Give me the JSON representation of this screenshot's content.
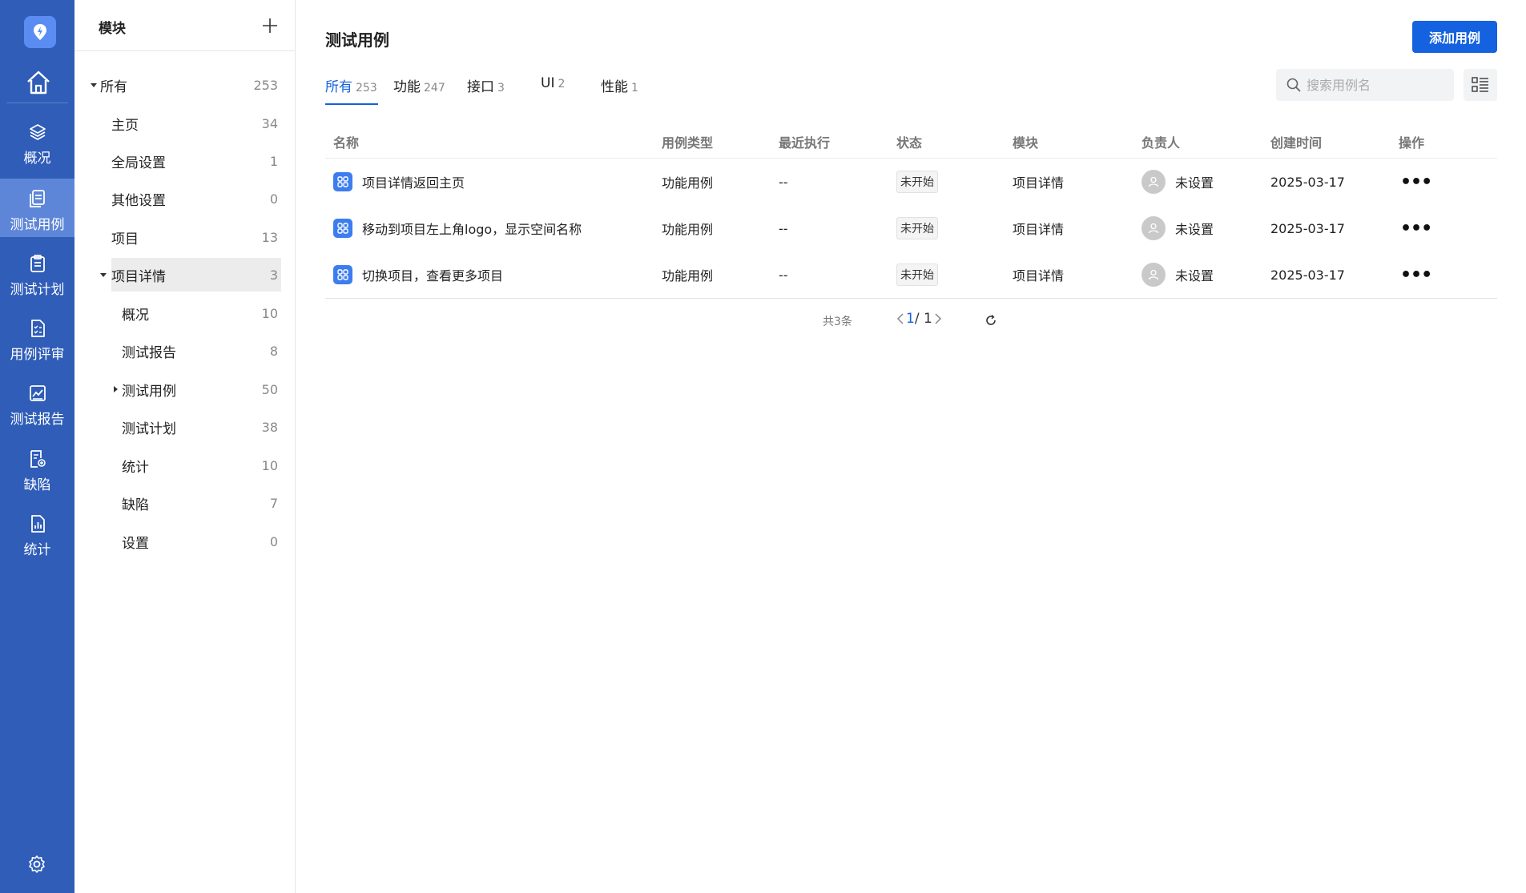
{
  "colors": {
    "rail": "#2f5db8",
    "rail_active": "#5d86d8",
    "primary": "#1462e0",
    "case_icon": "#3c7df0"
  },
  "rail": {
    "items": [
      {
        "label": "概况",
        "icon": "layers-icon"
      },
      {
        "label": "测试用例",
        "icon": "testcase-icon"
      },
      {
        "label": "测试计划",
        "icon": "clipboard-icon"
      },
      {
        "label": "用例评审",
        "icon": "review-doc-icon"
      },
      {
        "label": "测试报告",
        "icon": "chart-report-icon"
      },
      {
        "label": "缺陷",
        "icon": "bug-doc-icon"
      },
      {
        "label": "统计",
        "icon": "bar-chart-icon"
      }
    ]
  },
  "tree": {
    "title": "模块",
    "nodes": [
      {
        "label": "所有",
        "count": "253"
      },
      {
        "label": "主页",
        "count": "34"
      },
      {
        "label": "全局设置",
        "count": "1"
      },
      {
        "label": "其他设置",
        "count": "0"
      },
      {
        "label": "项目",
        "count": "13"
      },
      {
        "label": "项目详情",
        "count": "3"
      },
      {
        "label": "概况",
        "count": "10"
      },
      {
        "label": "测试报告",
        "count": "8"
      },
      {
        "label": "测试用例",
        "count": "50"
      },
      {
        "label": "测试计划",
        "count": "38"
      },
      {
        "label": "统计",
        "count": "10"
      },
      {
        "label": "缺陷",
        "count": "7"
      },
      {
        "label": "设置",
        "count": "0"
      }
    ]
  },
  "main": {
    "title": "测试用例",
    "add_button": "添加用例",
    "tabs": [
      {
        "label": "所有",
        "count": "253"
      },
      {
        "label": "功能",
        "count": "247"
      },
      {
        "label": "接口",
        "count": "3"
      },
      {
        "label": "UI",
        "count": "2"
      },
      {
        "label": "性能",
        "count": "1"
      }
    ],
    "search_placeholder": "搜索用例名",
    "columns": [
      "名称",
      "用例类型",
      "最近执行",
      "状态",
      "模块",
      "负责人",
      "创建时间",
      "操作"
    ],
    "rows": [
      {
        "name": "项目详情返回主页",
        "type": "功能用例",
        "last_run": "--",
        "status": "未开始",
        "module": "项目详情",
        "owner": "未设置",
        "created": "2025-03-17"
      },
      {
        "name": "移动到项目左上角logo，显示空间名称",
        "type": "功能用例",
        "last_run": "--",
        "status": "未开始",
        "module": "项目详情",
        "owner": "未设置",
        "created": "2025-03-17"
      },
      {
        "name": "切换项目，查看更多项目",
        "type": "功能用例",
        "last_run": "--",
        "status": "未开始",
        "module": "项目详情",
        "owner": "未设置",
        "created": "2025-03-17"
      }
    ],
    "pagination": {
      "total": "共3条",
      "current": "1",
      "separator": "/ 1"
    }
  }
}
